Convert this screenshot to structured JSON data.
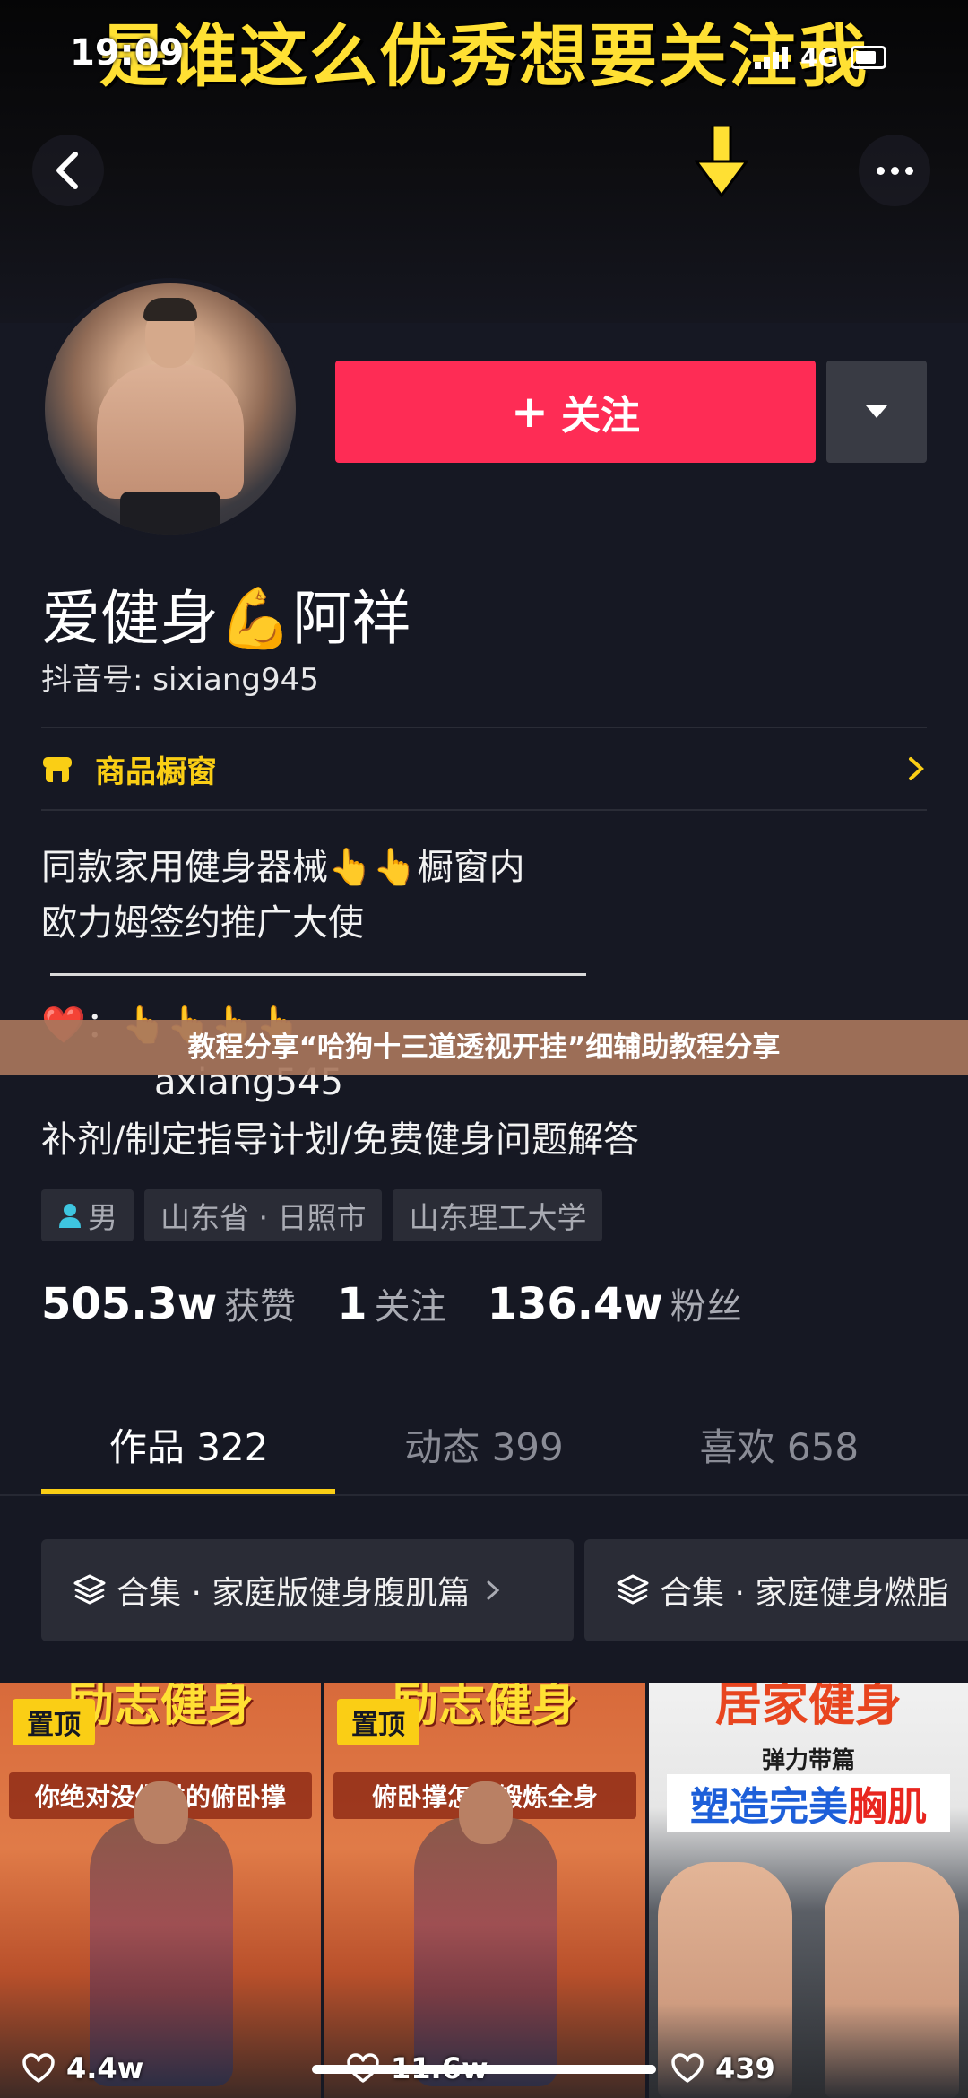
{
  "status_bar": {
    "time": "19:09",
    "network": "4G"
  },
  "banner": {
    "caption": "是谁这么优秀想要关注我"
  },
  "header": {
    "back_icon": "chevron-left-icon",
    "more_icon": "more-horizontal-icon"
  },
  "profile": {
    "follow_label": "关注",
    "nickname": "爱健身💪阿祥",
    "douyin_id": "抖音号: sixiang945",
    "shop": {
      "label": "商品橱窗"
    },
    "bio": {
      "line1": "同款家用健身器械👆👆橱窗内",
      "line2": "欧力姆签约推广大使",
      "line3": "❤️：👆👆👆👆",
      "line4": "axiang545",
      "line5": "补剂/制定指导计划/免费健身问题解答"
    },
    "tags": [
      "男",
      "山东省 · 日照市",
      "山东理工大学"
    ],
    "stats": [
      {
        "value": "505.3w",
        "label": "获赞"
      },
      {
        "value": "1",
        "label": "关注"
      },
      {
        "value": "136.4w",
        "label": "粉丝"
      }
    ]
  },
  "promo_overlay": "教程分享“哈狗十三道透视开挂”细辅助教程分享",
  "tabs": [
    {
      "label": "作品 322",
      "active": true
    },
    {
      "label": "动态 399",
      "active": false
    },
    {
      "label": "喜欢 658",
      "active": false
    }
  ],
  "collections": [
    {
      "label": "合集 · 家庭版健身腹肌篇"
    },
    {
      "label": "合集 · 家庭健身燃脂"
    }
  ],
  "videos": [
    {
      "title": "励志健身",
      "subtitle": "你绝对没做过的俯卧撑",
      "pin": "置顶",
      "likes": "4.4w"
    },
    {
      "title": "励志健身",
      "subtitle": "俯卧撑怎么锻炼全身",
      "pin": "置顶",
      "likes": "11.6w"
    },
    {
      "title": "居家健身",
      "subtitle": "弹力带篇",
      "headline": "塑造完美",
      "headline_accent": "胸肌",
      "likes": "439"
    }
  ],
  "colors": {
    "accent": "#fe2c55",
    "highlight": "#face15",
    "background": "#161823"
  }
}
